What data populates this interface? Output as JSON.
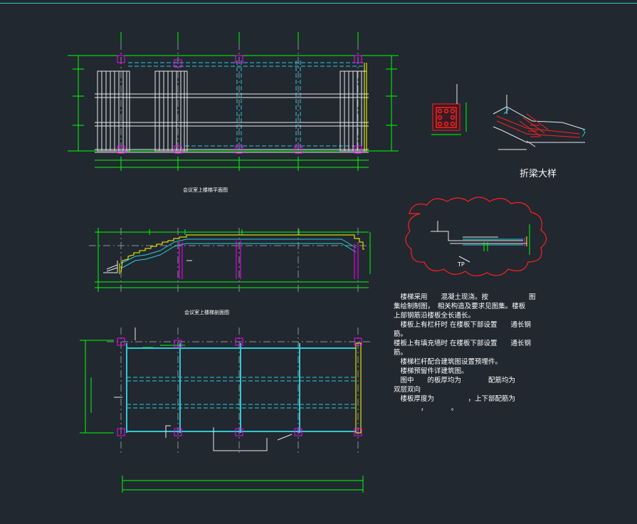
{
  "labels": {
    "plan_1": "会议室上楼梯平面图",
    "plan_2": "会议室上楼梯剖面图",
    "detail_title": "折梁大样",
    "tp_tag": "TP"
  },
  "notes": [
    "　楼梯采用　　混凝土现浇。按　　　　　　图",
    "集绘制制图，　相关构造及要求见图集。楼板",
    "上部钢筋沿楼板全长通长。",
    "　楼板上有栏杆时 在楼板下部设置　　通长钢",
    "筋。",
    "楼板上有填充墙时 在楼板下部设置　　通长钢",
    "筋。",
    "　楼梯栏杆配合建筑图设置预埋件。",
    "　楼梯预留件详建筑图。",
    "　图中　　的板厚均为　　　　配筋均为",
    "双层双向",
    "　楼板厚度为　　　　　，上下部配筋为",
    "　　　　，　　　　。"
  ],
  "colors": {
    "background": "#212830",
    "dimension": "#00ff00",
    "beam": "#30c8d8",
    "column": "#ff00ff",
    "rebar": "#ff2020",
    "wall": "#ffff00",
    "axis": "#ffffff"
  }
}
